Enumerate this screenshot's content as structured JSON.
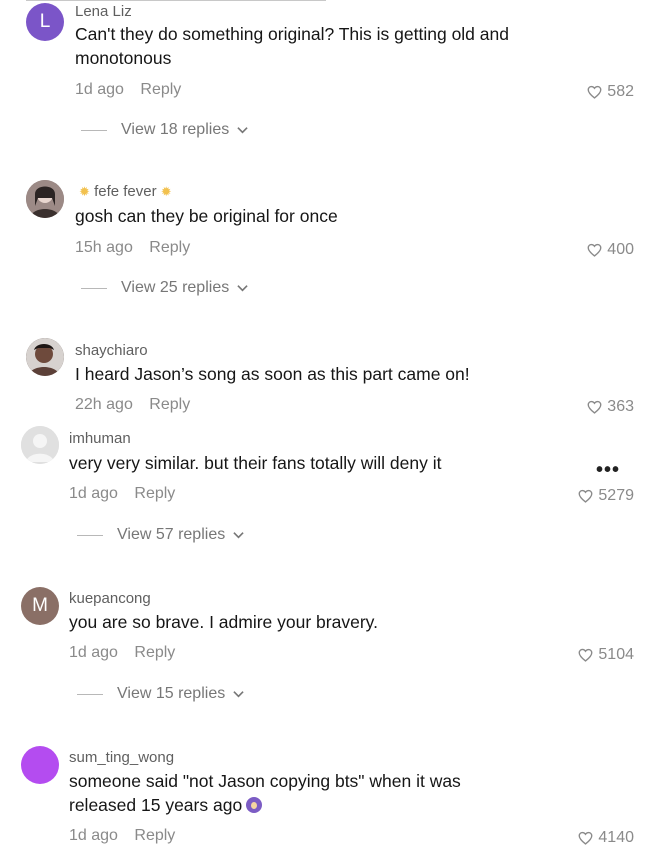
{
  "comments": [
    {
      "avatar_letter": "L",
      "avatar_color": "#7b55c8",
      "username": "Lena Liz",
      "text": "Can't they do something original? This is getting old and monotonous",
      "time": "1d ago",
      "reply_label": "Reply",
      "likes": "582",
      "view_replies": "View 18 replies"
    },
    {
      "avatar_letter": "",
      "avatar_color": "#8d7a77",
      "username": "fefe fever",
      "text": "gosh can they be original for once",
      "time": "15h ago",
      "reply_label": "Reply",
      "likes": "400",
      "view_replies": "View 25 replies"
    },
    {
      "avatar_letter": "",
      "avatar_color": "#4c3f3a",
      "username": "shaychiaro",
      "text": "I heard Jason’s song as soon as this part came on!",
      "time": "22h ago",
      "reply_label": "Reply",
      "likes": "363"
    },
    {
      "avatar_letter": "",
      "avatar_color": "#d9d9d9",
      "username": "imhuman",
      "text": "very very similar. but their fans totally will deny it",
      "time": "1d ago",
      "reply_label": "Reply",
      "likes": "5279",
      "view_replies": "View 57 replies"
    },
    {
      "avatar_letter": "M",
      "avatar_color": "#8a6f66",
      "username": "kuepancong",
      "text": "you are so brave. I admire your bravery.",
      "time": "1d ago",
      "reply_label": "Reply",
      "likes": "5104",
      "view_replies": "View 15 replies"
    },
    {
      "avatar_letter": "",
      "avatar_color": "#b44cf0",
      "username": "sum_ting_wong",
      "text": "someone said \"not Jason copying bts\" when it was released 15 years ago",
      "time": "1d ago",
      "reply_label": "Reply",
      "likes": "4140"
    }
  ],
  "icons": {
    "heart": "heart-icon",
    "chevron": "chevron-down-icon",
    "more": "more-options-icon",
    "sun": "sun-emoji-icon",
    "scream": "scream-emoji-icon"
  },
  "more_label": "•••"
}
